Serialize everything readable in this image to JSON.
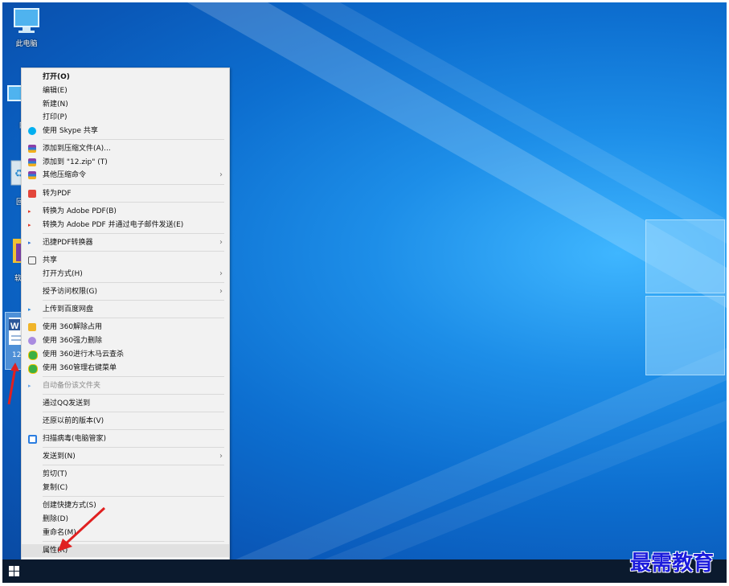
{
  "desktop": {
    "icons": [
      {
        "label": "此电脑",
        "icon": "computer-icon"
      },
      {
        "label": "网",
        "icon": "network-icon"
      },
      {
        "label": "回",
        "icon": "recycle-bin-icon"
      },
      {
        "label": "软",
        "icon": "software-folder-icon"
      },
      {
        "label": "12.",
        "icon": "word-document-icon"
      }
    ]
  },
  "context_menu": {
    "items": [
      {
        "label": "打开(O)",
        "bold": true
      },
      {
        "label": "编辑(E)"
      },
      {
        "label": "新建(N)"
      },
      {
        "label": "打印(P)"
      },
      {
        "label": "使用 Skype 共享",
        "icon": "skype-icon"
      },
      {
        "label": "添加到压缩文件(A)...",
        "icon": "winrar-icon"
      },
      {
        "label": "添加到 \"12.zip\" (T)",
        "icon": "winrar-icon"
      },
      {
        "label": "其他压缩命令",
        "icon": "winrar-icon",
        "submenu": true
      },
      {
        "label": "转为PDF",
        "icon": "pdf-icon"
      },
      {
        "label": "转换为 Adobe PDF(B)",
        "icon": "adobe-icon"
      },
      {
        "label": "转换为 Adobe PDF 并通过电子邮件发送(E)",
        "icon": "adobe-icon"
      },
      {
        "label": "迅捷PDF转换器",
        "icon": "xunjie-icon",
        "submenu": true
      },
      {
        "label": "共享",
        "icon": "share-icon"
      },
      {
        "label": "打开方式(H)",
        "submenu": true
      },
      {
        "label": "授予访问权限(G)",
        "submenu": true
      },
      {
        "label": "上传到百度网盘",
        "icon": "baidu-icon"
      },
      {
        "label": "使用 360解除占用",
        "icon": "folder-icon"
      },
      {
        "label": "使用 360强力删除",
        "icon": "delete-icon"
      },
      {
        "label": "使用 360进行木马云查杀",
        "icon": "360-icon"
      },
      {
        "label": "使用 360管理右键菜单",
        "icon": "360-icon"
      },
      {
        "label": "自动备份该文件夹",
        "icon": "backup-icon",
        "disabled": true
      },
      {
        "label": "通过QQ发送到"
      },
      {
        "label": "还原以前的版本(V)"
      },
      {
        "label": "扫描病毒(电脑管家)",
        "icon": "shield-icon"
      },
      {
        "label": "发送到(N)",
        "submenu": true
      },
      {
        "label": "剪切(T)"
      },
      {
        "label": "复制(C)"
      },
      {
        "label": "创建快捷方式(S)"
      },
      {
        "label": "删除(D)"
      },
      {
        "label": "重命名(M)"
      },
      {
        "label": "属性(R)",
        "highlighted": true
      }
    ],
    "submenu_arrow": "›"
  },
  "watermark": "最需教育",
  "colors": {
    "accent": "#0078d7",
    "taskbar": "#0b1a2e",
    "watermark": "#1c1cdc"
  }
}
